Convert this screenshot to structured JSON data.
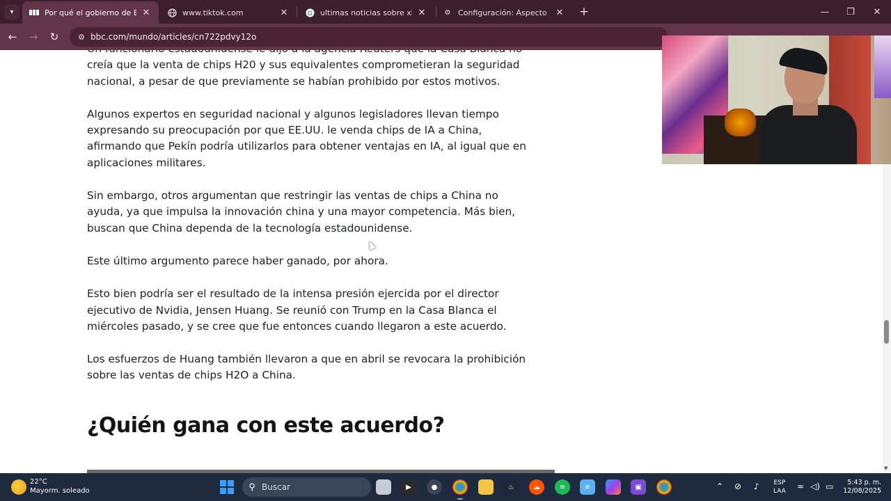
{
  "browser": {
    "tabs": [
      {
        "title": "Por qué el gobierno de EE.UU. a",
        "favicon": "bbc-icon",
        "active": true
      },
      {
        "title": "www.tiktok.com",
        "favicon": "globe-icon",
        "active": false
      },
      {
        "title": "ultimas noticias sobre xbox - Bu",
        "favicon": "google-icon",
        "active": false
      },
      {
        "title": "Configuración: Aspecto",
        "favicon": "gear-icon",
        "active": false
      }
    ],
    "address": "bbc.com/mundo/articles/cn722pdvy12o"
  },
  "article": {
    "paragraphs": [
      "Un funcionario estadounidense le dijo a la agencia Reuters que la Casa Blanca no creía que la venta de chips H20 y sus equivalentes comprometieran la seguridad nacional, a pesar de que previamente se habían prohibido por estos motivos.",
      "Algunos expertos en seguridad nacional y algunos legisladores llevan tiempo expresando su preocupación por que EE.UU. le venda chips de IA a China, afirmando que Pekín podría utilizarlos para obtener ventajas en IA, al igual que en aplicaciones militares.",
      "Sin embargo, otros argumentan que restringir las ventas de chips a China no ayuda, ya que impulsa la innovación china y una mayor competencia. Más bien, buscan que China dependa de la tecnología estadounidense.",
      "Este último argumento parece haber ganado, por ahora.",
      "Esto bien podría ser el resultado de la intensa presión ejercida por el director ejecutivo de Nvidia, Jensen Huang. Se reunió con Trump en la Casa Blanca el miércoles pasado, y se cree que fue entonces cuando llegaron a este acuerdo.",
      "Los esfuerzos de Huang también llevaron a que en abril se revocara la prohibición sobre las ventas de chips H2O a China."
    ],
    "heading": "¿Quién gana con este acuerdo?"
  },
  "taskbar": {
    "weather_temp": "22°C",
    "weather_desc": "Mayorm. soleado",
    "search_placeholder": "Buscar",
    "lang_line1": "ESP",
    "lang_line2": "LAA",
    "time": "5:43 p. m.",
    "date": "12/08/2025"
  }
}
